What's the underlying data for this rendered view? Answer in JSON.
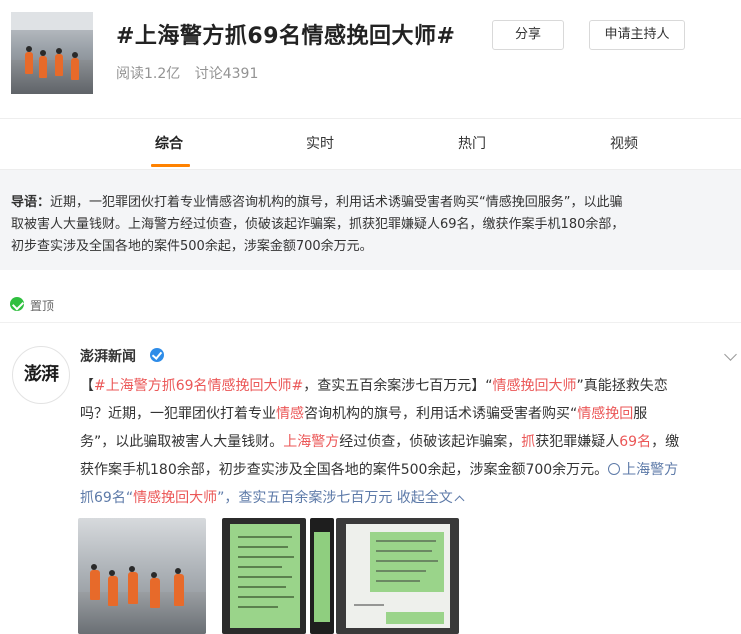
{
  "header": {
    "title": "#上海警方抓69名情感挽回大师#",
    "stats": {
      "read": "阅读1.2亿",
      "discuss": "讨论4391"
    },
    "share_label": "分享",
    "host_label": "申请主持人"
  },
  "tabs": [
    {
      "label": "综合",
      "active": true
    },
    {
      "label": "实时",
      "active": false
    },
    {
      "label": "热门",
      "active": false
    },
    {
      "label": "视频",
      "active": false
    }
  ],
  "intro": {
    "label": "导语：",
    "line1": "近期，一犯罪团伙打着专业情感咨询机构的旗号，利用话术诱骗受害者购买“情感挽回服务”，以此骗",
    "line2": "取被害人大量钱财。上海警方经过侦查，侦破该起诈骗案，抓获犯罪嫌疑人69名，缴获作案手机180余部，",
    "line3": "初步查实涉及全国各地的案件500余起，涉案金额700余万元。"
  },
  "pinned": {
    "label": "置顶"
  },
  "post": {
    "author": "澎湃新闻",
    "avatar_text": "澎湃",
    "l1a": "【",
    "l1b": "#上海警方抓69名情感挽回大师#",
    "l1c": "，查实五百余案涉七百万元】",
    "l1d": "“",
    "l1e": "情感挽回大师",
    "l1f": "”真能拯救失恋",
    "l2a": "吗？近期，一犯罪团伙打着专业",
    "l2b": "情感",
    "l2c": "咨询机构的旗号，利用话术诱骗受害者购买“",
    "l2d": "情感挽回",
    "l2e": "服",
    "l3a": "务”，以此骗取被害人大量钱财。",
    "l3b": "上海警方",
    "l3c": "经过侦查，侦破该起诈骗案，",
    "l3d": "抓",
    "l3e": "获犯罪嫌疑人",
    "l3f": "69名",
    "l3g": "，缴",
    "l4a": "获作案手机180余部，初步查实涉及全国各地的案件500余起，涉案金额700余万元。",
    "l4b": "上海警方",
    "l5a": "抓69名“",
    "l5b": "情感挽回大师",
    "l5c": "”，查实五百余案涉七百万元",
    "l5d": " 收起全文"
  },
  "colors": {
    "accent": "#ff8200",
    "highlight": "#eb5757",
    "link": "#5d7aa8",
    "intro_bg": "#f4f5f7"
  }
}
